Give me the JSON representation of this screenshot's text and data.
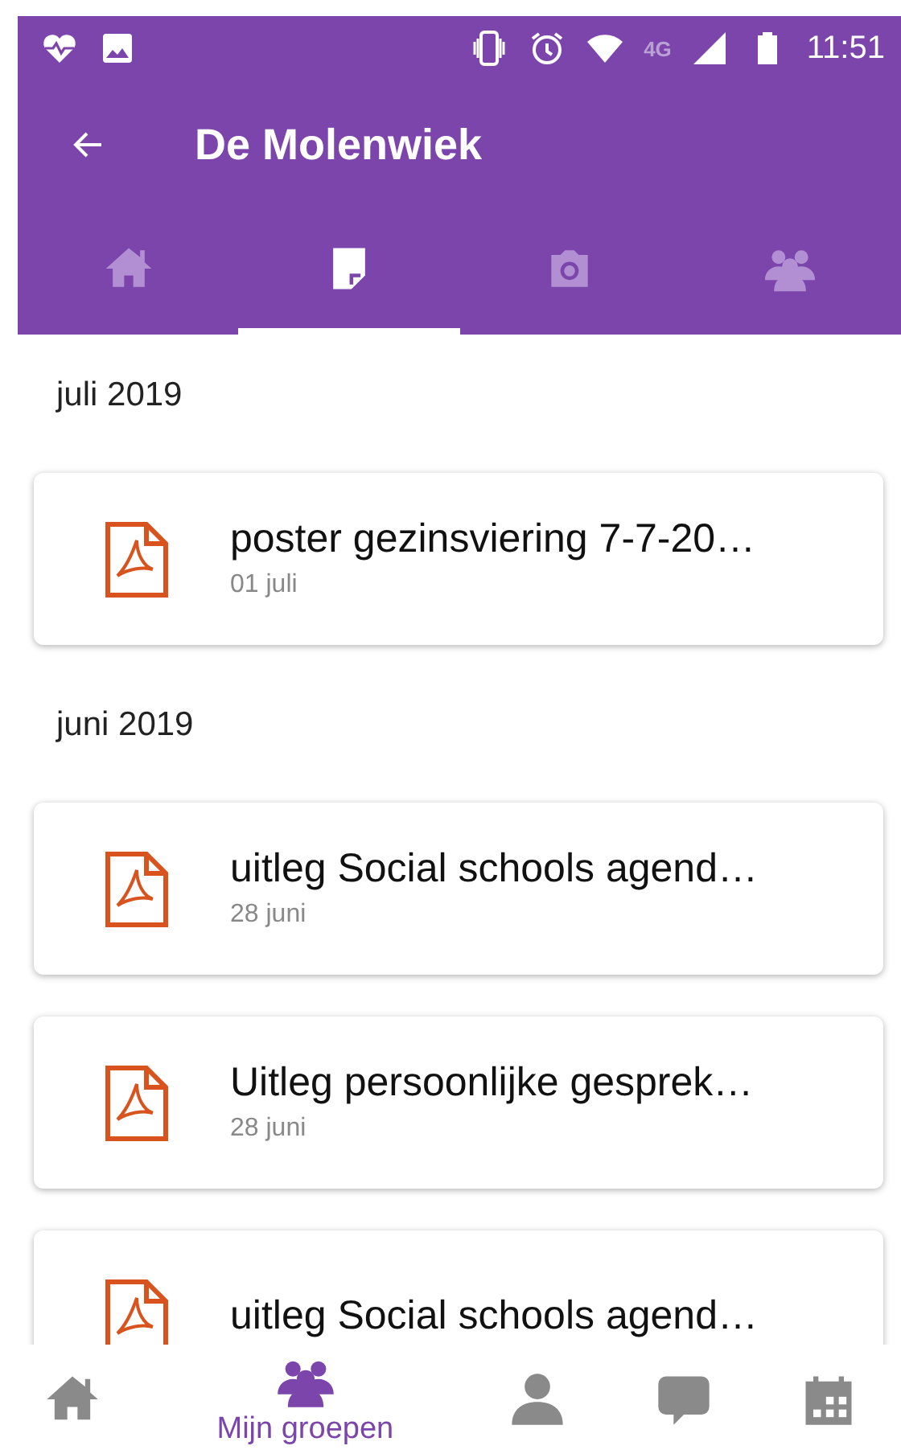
{
  "status_bar": {
    "time": "11:51",
    "network": "4G"
  },
  "toolbar": {
    "title": "De Molenwiek"
  },
  "tabs": [
    {
      "selected": false
    },
    {
      "selected": true
    },
    {
      "selected": false
    },
    {
      "selected": false
    }
  ],
  "sections": [
    {
      "heading": "juli 2019",
      "items": [
        {
          "title": "poster gezinsviering 7-7-20…",
          "date": "01 juli"
        }
      ]
    },
    {
      "heading": "juni 2019",
      "items": [
        {
          "title": "uitleg Social schools agend…",
          "date": "28 juni"
        },
        {
          "title": "Uitleg persoonlijke gesprek…",
          "date": "28 juni"
        },
        {
          "title": "uitleg Social schools agend…"
        }
      ]
    }
  ],
  "bottom_nav": [
    {
      "selected": false
    },
    {
      "selected": true,
      "label": "Mijn groepen"
    },
    {
      "selected": false
    },
    {
      "selected": false
    },
    {
      "selected": false
    }
  ]
}
